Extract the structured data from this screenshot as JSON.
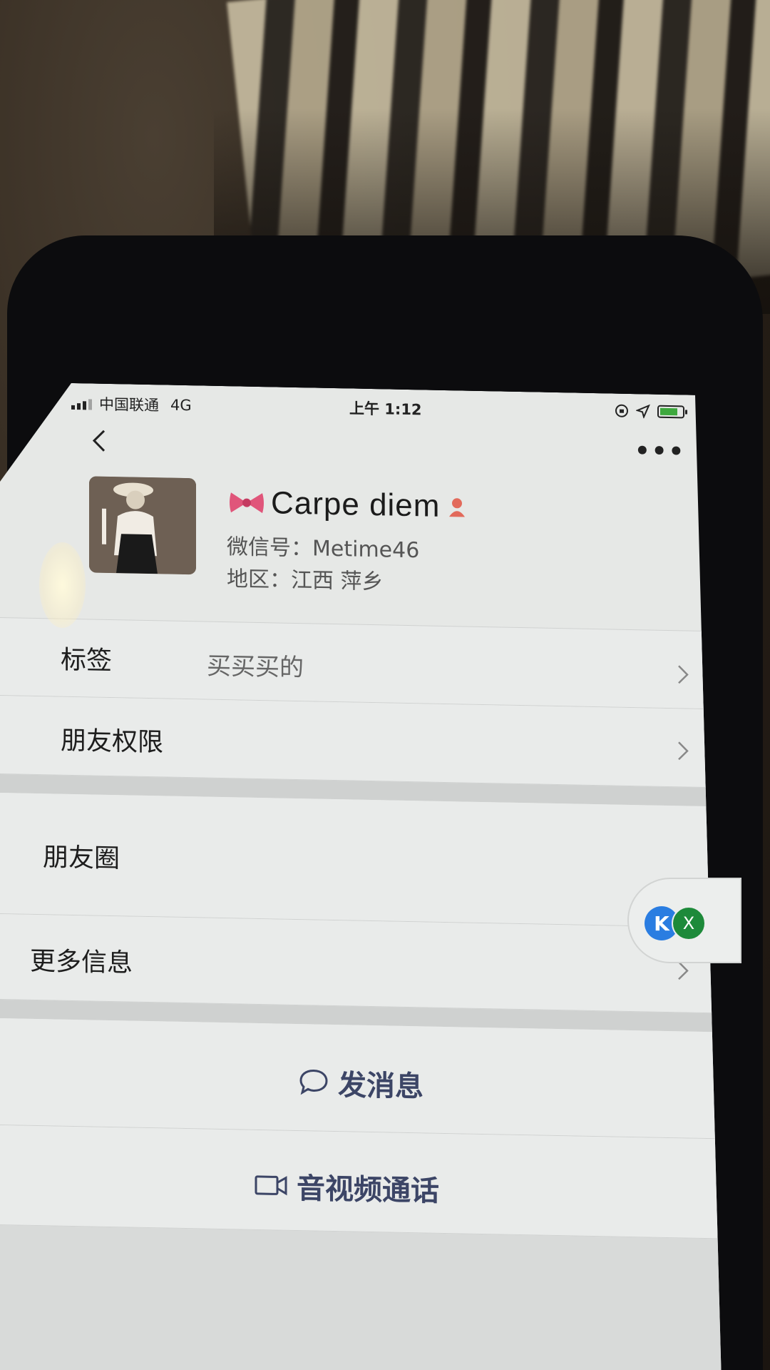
{
  "status_bar": {
    "carrier": "中国联通",
    "network": "4G",
    "time": "上午 1:12"
  },
  "profile": {
    "nickname": "Carpe  diem",
    "wechat_id": "微信号：Metime46",
    "region": "地区：江西 萍乡"
  },
  "rows": {
    "tags_label": "标签",
    "tags_value": "买买买的",
    "permissions_label": "朋友权限",
    "moments_label": "朋友圈",
    "more_info_label": "更多信息"
  },
  "floating_widget": {
    "k_glyph": "K",
    "x_glyph": "X"
  },
  "actions": {
    "message_label": "发消息",
    "call_label": "音视频通话"
  },
  "colors": {
    "action_text": "#3c4566",
    "screen_bg": "#e6e8e6",
    "widget_blue": "#2a7de1",
    "widget_green": "#1d8a3a"
  }
}
